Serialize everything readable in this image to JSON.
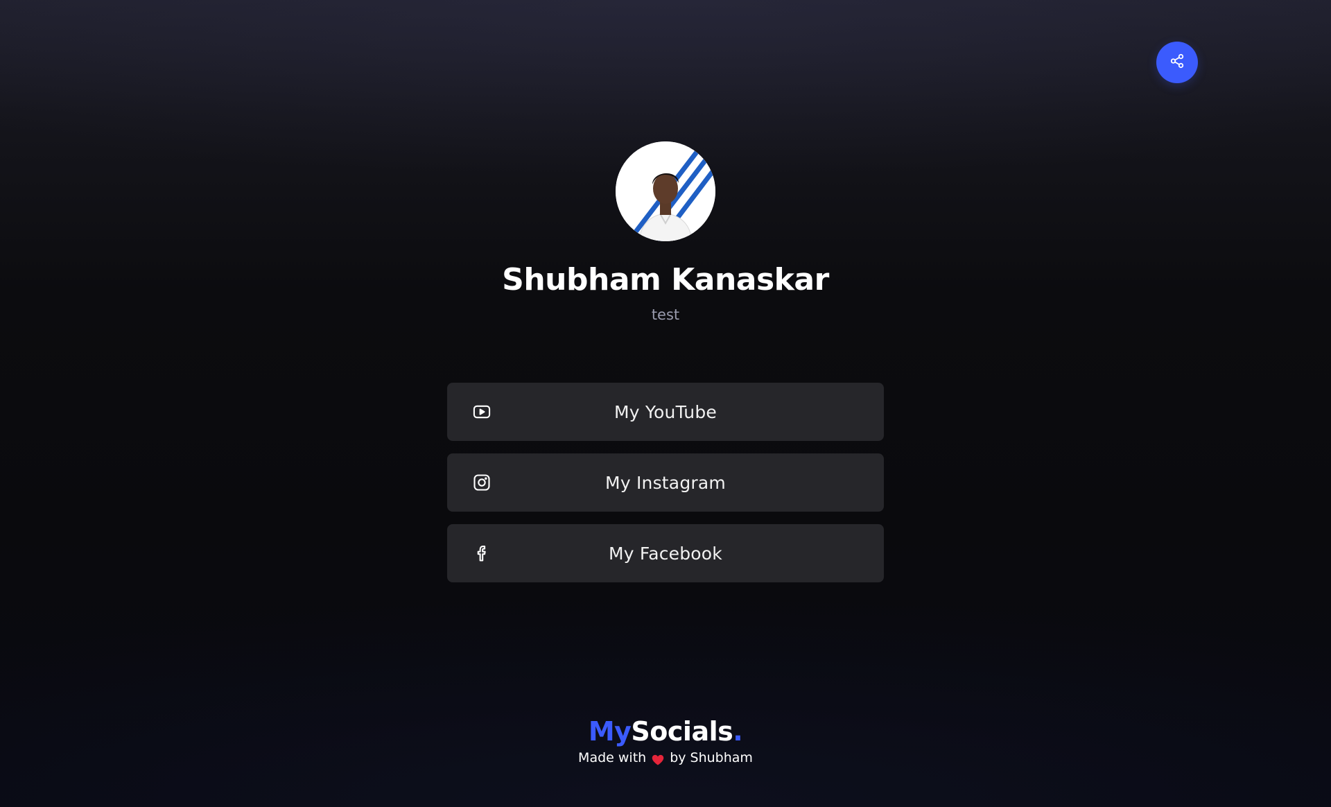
{
  "profile": {
    "name": "Shubham Kanaskar",
    "bio": "test",
    "avatar_icon": "profile-photo"
  },
  "share": {
    "icon": "share-icon",
    "color": "#3b5bfd"
  },
  "links": [
    {
      "label": "My YouTube",
      "icon": "youtube-icon"
    },
    {
      "label": "My Instagram",
      "icon": "instagram-icon"
    },
    {
      "label": "My Facebook",
      "icon": "facebook-icon"
    }
  ],
  "footer": {
    "brand_my": "My",
    "brand_socials": "Socials",
    "brand_dot": ".",
    "credit_prefix": "Made with",
    "credit_suffix": "by Shubham",
    "heart_icon": "heart-icon"
  },
  "colors": {
    "accent": "#3b5bfd",
    "card": "#26262a",
    "muted_text": "#9a9cae"
  }
}
